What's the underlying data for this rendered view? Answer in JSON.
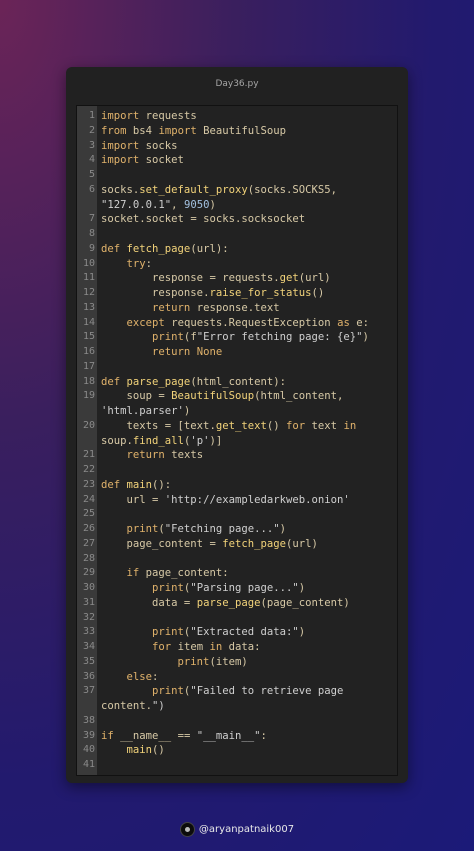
{
  "window": {
    "title": "Day36.py"
  },
  "footer": {
    "handle": "@aryanpatnaik007"
  },
  "code": {
    "lines": [
      {
        "n": "1",
        "t": "import requests"
      },
      {
        "n": "2",
        "t": "from bs4 import BeautifulSoup"
      },
      {
        "n": "3",
        "t": "import socks"
      },
      {
        "n": "4",
        "t": "import socket"
      },
      {
        "n": "5",
        "t": ""
      },
      {
        "n": "6",
        "t": "socks.set_default_proxy(socks.SOCKS5,"
      },
      {
        "n": "",
        "t": "\"127.0.0.1\", 9050)"
      },
      {
        "n": "7",
        "t": "socket.socket = socks.socksocket"
      },
      {
        "n": "8",
        "t": ""
      },
      {
        "n": "9",
        "t": "def fetch_page(url):"
      },
      {
        "n": "10",
        "t": "    try:"
      },
      {
        "n": "11",
        "t": "        response = requests.get(url)"
      },
      {
        "n": "12",
        "t": "        response.raise_for_status()"
      },
      {
        "n": "13",
        "t": "        return response.text"
      },
      {
        "n": "14",
        "t": "    except requests.RequestException as e:"
      },
      {
        "n": "15",
        "t": "        print(f\"Error fetching page: {e}\")"
      },
      {
        "n": "16",
        "t": "        return None"
      },
      {
        "n": "17",
        "t": ""
      },
      {
        "n": "18",
        "t": "def parse_page(html_content):"
      },
      {
        "n": "19",
        "t": "    soup = BeautifulSoup(html_content,"
      },
      {
        "n": "",
        "t": "'html.parser')"
      },
      {
        "n": "20",
        "t": "    texts = [text.get_text() for text in"
      },
      {
        "n": "",
        "t": "soup.find_all('p')]"
      },
      {
        "n": "21",
        "t": "    return texts"
      },
      {
        "n": "22",
        "t": ""
      },
      {
        "n": "23",
        "t": "def main():"
      },
      {
        "n": "24",
        "t": "    url = 'http://exampledarkweb.onion'"
      },
      {
        "n": "25",
        "t": ""
      },
      {
        "n": "26",
        "t": "    print(\"Fetching page...\")"
      },
      {
        "n": "27",
        "t": "    page_content = fetch_page(url)"
      },
      {
        "n": "28",
        "t": ""
      },
      {
        "n": "29",
        "t": "    if page_content:"
      },
      {
        "n": "30",
        "t": "        print(\"Parsing page...\")"
      },
      {
        "n": "31",
        "t": "        data = parse_page(page_content)"
      },
      {
        "n": "32",
        "t": ""
      },
      {
        "n": "33",
        "t": "        print(\"Extracted data:\")"
      },
      {
        "n": "34",
        "t": "        for item in data:"
      },
      {
        "n": "35",
        "t": "            print(item)"
      },
      {
        "n": "36",
        "t": "    else:"
      },
      {
        "n": "37",
        "t": "        print(\"Failed to retrieve page"
      },
      {
        "n": "",
        "t": "content.\")"
      },
      {
        "n": "38",
        "t": ""
      },
      {
        "n": "39",
        "t": "if __name__ == \"__main__\":"
      },
      {
        "n": "40",
        "t": "    main()"
      },
      {
        "n": "41",
        "t": ""
      }
    ]
  }
}
